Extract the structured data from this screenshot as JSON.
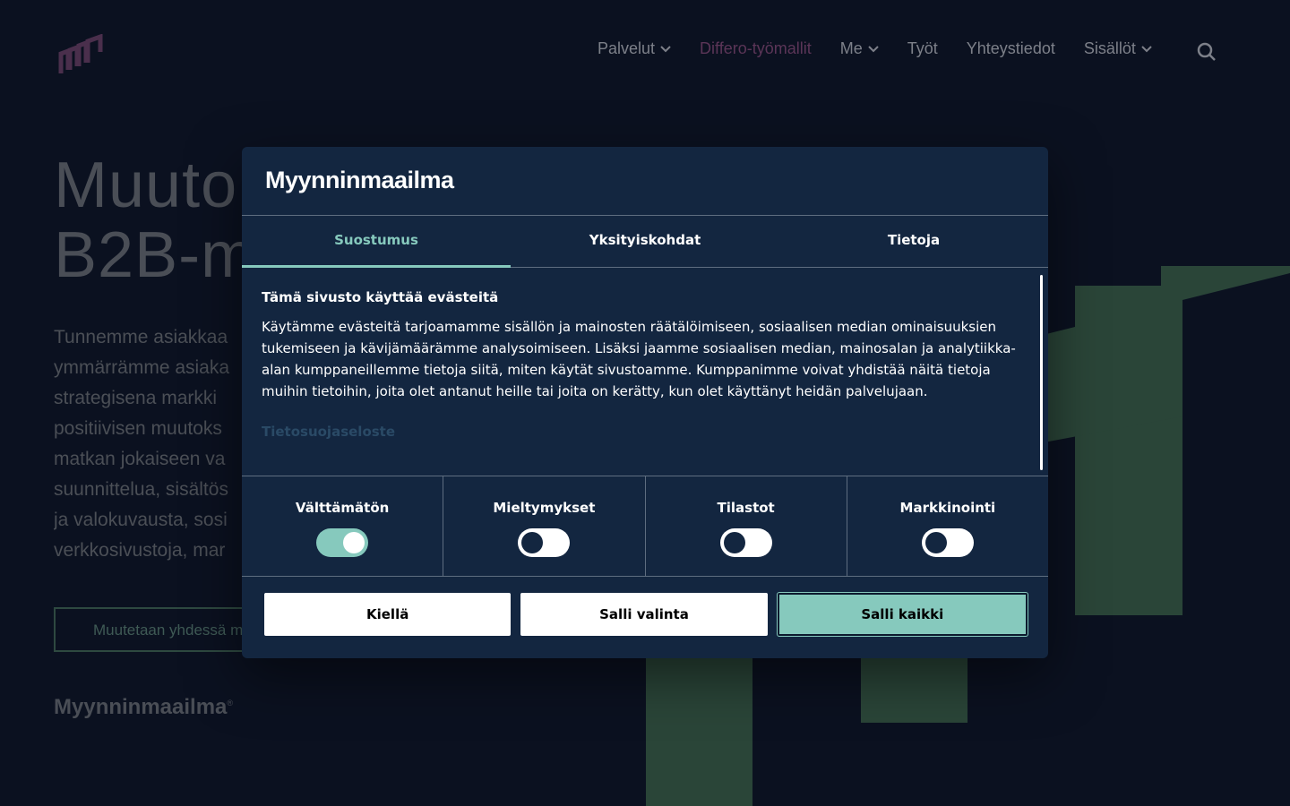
{
  "nav": {
    "items": [
      {
        "label": "Palvelut",
        "dropdown": true
      },
      {
        "label": "Differo-työmallit",
        "dropdown": false,
        "active": true
      },
      {
        "label": "Me",
        "dropdown": true
      },
      {
        "label": "Työt",
        "dropdown": false
      },
      {
        "label": "Yhteystiedot",
        "dropdown": false
      },
      {
        "label": "Sisällöt",
        "dropdown": true
      }
    ],
    "search_icon": "search-icon",
    "logo_icon": "brand-mark-icon"
  },
  "hero": {
    "title_line1": "Muuto",
    "title_line2": "B2B-m",
    "text_lines": [
      "Tunnemme asiakkaa",
      "ymmärrämme asiaka",
      "strategisena markki",
      "positiivisen muutoks",
      "matkan jokaiseen va",
      "suunnittelua, sisältös",
      "ja valokuvausta, sosi",
      "verkkosivustoja, mar"
    ],
    "cta_label": "Muutetaan yhdessä m",
    "footer_brand": "Myynninmaailma",
    "footer_brand_mark": "®"
  },
  "dialog": {
    "brand": "Myynninmaailma",
    "tabs": [
      {
        "label": "Suostumus",
        "active": true
      },
      {
        "label": "Yksityiskohdat",
        "active": false
      },
      {
        "label": "Tietoja",
        "active": false
      }
    ],
    "content_title": "Tämä sivusto käyttää evästeitä",
    "content_body": "Käytämme evästeitä tarjoamamme sisällön ja mainosten räätälöimiseen, sosiaalisen median ominaisuuksien tukemiseen ja kävijämäärämme analysoimiseen. Lisäksi jaamme sosiaalisen median, mainosalan ja analytiikka-alan kumppaneillemme tietoja siitä, miten käytät sivustoamme. Kumppanimme voivat yhdistää näitä tietoja muihin tietoihin, joita olet antanut heille tai joita on kerätty, kun olet käyttänyt heidän palvelujaan.",
    "privacy_link": "Tietosuojaseloste",
    "toggles": [
      {
        "label": "Välttämätön",
        "on": true
      },
      {
        "label": "Mieltymykset",
        "on": false
      },
      {
        "label": "Tilastot",
        "on": false
      },
      {
        "label": "Markkinointi",
        "on": false
      }
    ],
    "buttons": {
      "deny": "Kiellä",
      "allow_selection": "Salli valinta",
      "allow_all": "Salli kaikki"
    }
  },
  "colors": {
    "accent": "#86c9bd",
    "dialog_bg": "#132640",
    "page_bg": "#0b1120",
    "nav_active": "#5b3557"
  }
}
